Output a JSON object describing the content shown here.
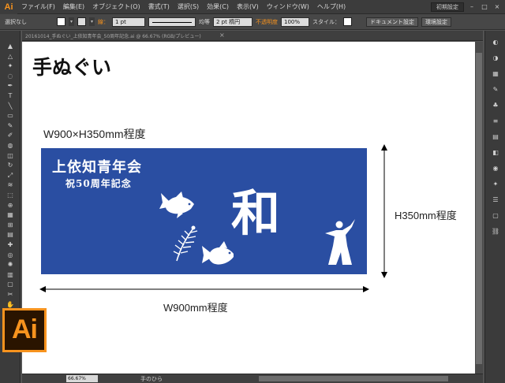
{
  "app": {
    "logo": "Ai",
    "menu": [
      "ファイル(F)",
      "編集(E)",
      "オブジェクト(O)",
      "書式(T)",
      "選択(S)",
      "効果(C)",
      "表示(V)",
      "ウィンドウ(W)",
      "ヘルプ(H)"
    ],
    "workspace": "初期設定",
    "window_controls": [
      "–",
      "□",
      "×"
    ]
  },
  "control_bar": {
    "selection": "選択なし",
    "stroke_label": "線：",
    "stroke_weight": "1 pt",
    "stroke_profile": "均等",
    "brush": "2 pt 楕円",
    "opacity_label": "不透明度",
    "opacity": "100%",
    "style_label": "スタイル：",
    "doc_setup": "ドキュメント設定",
    "prefs": "環境設定"
  },
  "document": {
    "tab_label": "20161014_手ぬぐい_上依知青年会_50周年記念.ai @ 66.67% (RGB/プレビュー)",
    "close_glyph": "×"
  },
  "status_bar": {
    "zoom": "66.67%",
    "tool": "手のひら"
  },
  "artwork": {
    "title": "手ぬぐい",
    "size_label": "W900×H350mm程度",
    "towel_org": "上依知青年会",
    "towel_sub": "祝50周年記念",
    "towel_kanji": "和",
    "height_label": "H350mm程度",
    "width_label": "W900mm程度",
    "towel_color": "#2a4ea2"
  },
  "colors": {
    "accent": "#f7931e",
    "ui_dark": "#3c3c3c",
    "ui_mid": "#535353"
  },
  "icons": {
    "left_tools": [
      "selection-tool-icon",
      "direct-selection-tool-icon",
      "magic-wand-tool-icon",
      "lasso-tool-icon",
      "pen-tool-icon",
      "type-tool-icon",
      "line-tool-icon",
      "rectangle-tool-icon",
      "paintbrush-tool-icon",
      "pencil-tool-icon",
      "blob-brush-tool-icon",
      "eraser-tool-icon",
      "rotate-tool-icon",
      "scale-tool-icon",
      "width-tool-icon",
      "free-transform-tool-icon",
      "shape-builder-tool-icon",
      "perspective-grid-tool-icon",
      "mesh-tool-icon",
      "gradient-tool-icon",
      "eyedropper-tool-icon",
      "blend-tool-icon",
      "symbol-sprayer-tool-icon",
      "column-graph-tool-icon",
      "artboard-tool-icon",
      "slice-tool-icon",
      "hand-tool-icon",
      "zoom-tool-icon"
    ],
    "right_dock": [
      "color-panel-icon",
      "color-guide-icon",
      "swatches-icon",
      "brushes-icon",
      "symbols-icon",
      "stroke-icon",
      "gradient-icon",
      "transparency-icon",
      "appearance-icon",
      "graphic-styles-icon",
      "layers-icon",
      "artboards-icon",
      "links-icon"
    ]
  }
}
